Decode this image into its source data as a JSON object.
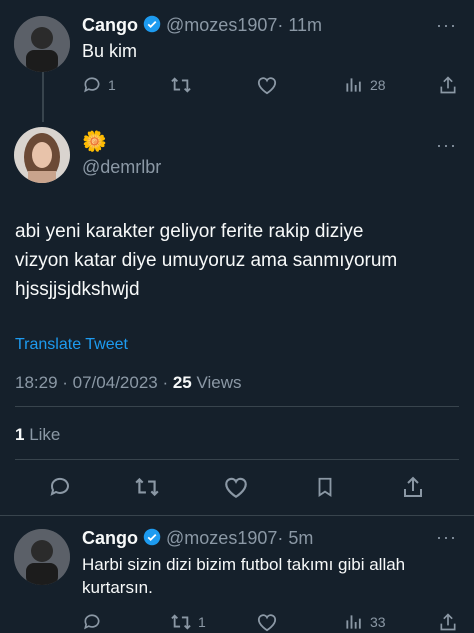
{
  "tweet1": {
    "name": "Cango",
    "handle": "@mozes1907",
    "time": "· 11m",
    "text": "Bu kim",
    "replies": "1",
    "views": "28"
  },
  "main": {
    "name_emoji": "🌼",
    "handle": "@demrlbr",
    "text_line1": "abi yeni karakter geliyor ferite rakip diziye",
    "text_line2": "vizyon katar diye umuyoruz ama sanmıyorum",
    "text_line3": "hjssjjsjdkshwjd",
    "translate": "Translate Tweet",
    "timestamp": "18:29 · 07/04/2023 · ",
    "views_count": "25",
    "views_label": " Views",
    "likes_count": "1",
    "likes_label": " Like"
  },
  "tweet2": {
    "name": "Cango",
    "handle": "@mozes1907",
    "time": "· 5m",
    "text_line1": "Harbi sizin dizi bizim futbol takımı gibi allah",
    "text_line2": "kurtarsın.",
    "retweets": "1",
    "views": "33"
  },
  "colors": {
    "background": "#15202b",
    "link": "#1d9bf0",
    "muted": "#8b98a5",
    "divider": "#38444d"
  }
}
